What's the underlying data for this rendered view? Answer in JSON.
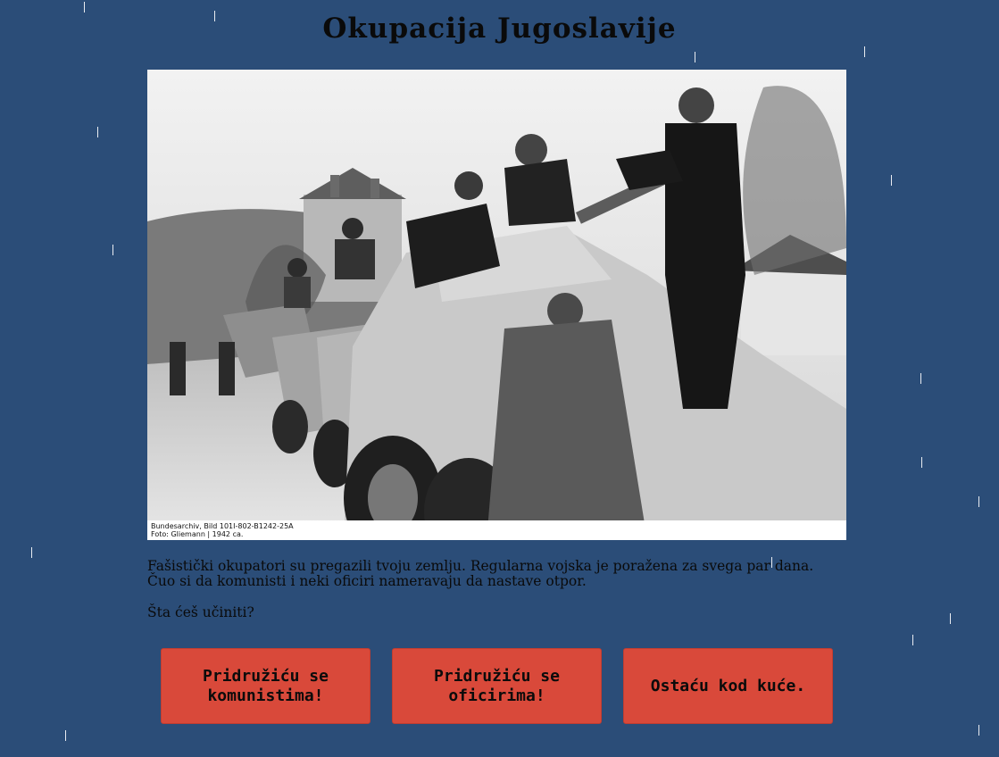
{
  "game": {
    "title": "Okupacija Jugoslavije",
    "image": {
      "caption_line1": "Bundesarchiv, Bild 101I-802-B1242-25A",
      "caption_line2": "Foto: Gliemann | 1942 ca."
    },
    "story": "Fašistički okupatori su pregazili tvoju zemlju. Regularna vojska je poražena za svega par dana. Čuo si da komunisti i neki oficiri nameravaju da nastave otpor.",
    "question": "Šta ćeš učiniti?",
    "choices": [
      {
        "label": "Pridružiću se komunistima!"
      },
      {
        "label": "Pridružiću se oficirima!"
      },
      {
        "label": "Ostaću kod kuće."
      }
    ]
  },
  "colors": {
    "background": "#2b4d78",
    "button": "#d9493a",
    "rain": "#ffffff"
  }
}
